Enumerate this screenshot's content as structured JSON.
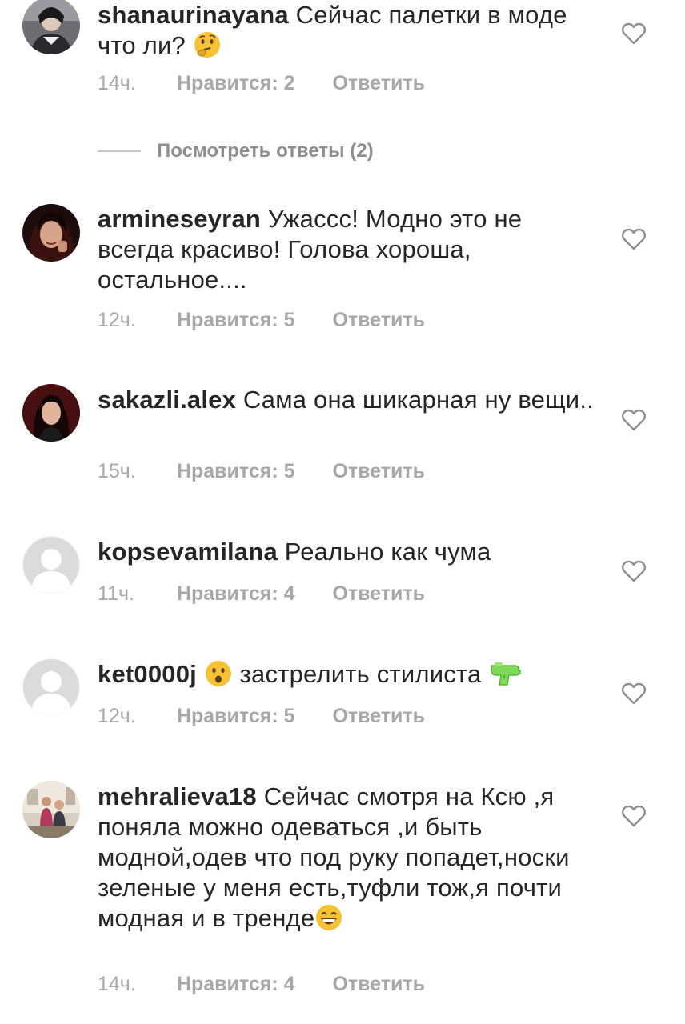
{
  "comments": [
    {
      "username": "shanaurinayana",
      "text": "Сейчас палетки в моде что ли?",
      "emoji": "thinking-face",
      "time": "14ч.",
      "likes": "Нравится: 2",
      "reply": "Ответить",
      "view_replies": "Посмотреть ответы (2)"
    },
    {
      "username": "armineseyran",
      "text": "Ужассс! Модно это не всегда красиво! Голова хороша, остальное....",
      "time": "12ч.",
      "likes": "Нравится: 5",
      "reply": "Ответить"
    },
    {
      "username": "sakazli.alex",
      "text": "Сама она шикарная ну вещи..",
      "time": "15ч.",
      "likes": "Нравится: 5",
      "reply": "Ответить"
    },
    {
      "username": "kopsevamilana",
      "text": "Реально как чума",
      "time": "11ч.",
      "likes": "Нравится: 4",
      "reply": "Ответить"
    },
    {
      "username": "ket0000j",
      "emoji_before": "frowning-face",
      "text": "застрелить стилиста",
      "emoji": "water-pistol",
      "time": "12ч.",
      "likes": "Нравится: 5",
      "reply": "Ответить"
    },
    {
      "username": "mehralieva18",
      "text": "Сейчас смотря на Ксю ,я поняла можно одеваться ,и быть модной,одев что под руку попадет,носки зеленые у меня есть,туфли тож,я почти модная и в тренде",
      "emoji": "grinning-face",
      "time": "14ч.",
      "likes": "Нравится: 4",
      "reply": "Ответить"
    }
  ],
  "colors": {
    "text": "#262626",
    "meta": "#a8a8a8",
    "view_replies": "#8e8e8e",
    "heart": "#8e8e8e"
  },
  "icons": [
    "heart-outline-icon",
    "avatar-placeholder-icon"
  ]
}
